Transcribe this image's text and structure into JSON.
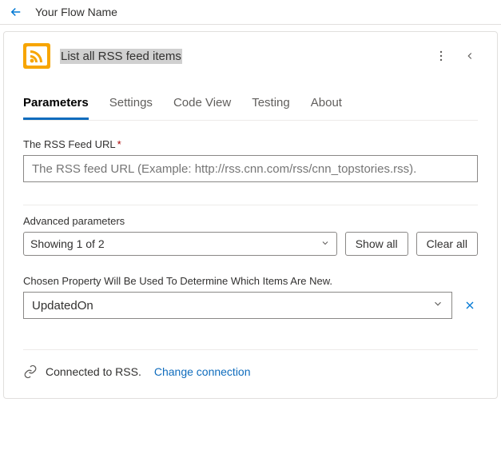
{
  "header": {
    "flow_name": "Your Flow Name"
  },
  "action": {
    "title": "List all RSS feed items"
  },
  "tabs": {
    "parameters": "Parameters",
    "settings": "Settings",
    "code_view": "Code View",
    "testing": "Testing",
    "about": "About"
  },
  "fields": {
    "rss_url_label": "The RSS Feed URL",
    "rss_url_placeholder": "The RSS feed URL (Example: http://rss.cnn.com/rss/cnn_topstories.rss)."
  },
  "advanced": {
    "label": "Advanced parameters",
    "showing": "Showing 1 of 2",
    "show_all": "Show all",
    "clear_all": "Clear all"
  },
  "chosen": {
    "label": "Chosen Property Will Be Used To Determine Which Items Are New.",
    "value": "UpdatedOn"
  },
  "connection": {
    "status": "Connected to RSS.",
    "change": "Change connection"
  }
}
